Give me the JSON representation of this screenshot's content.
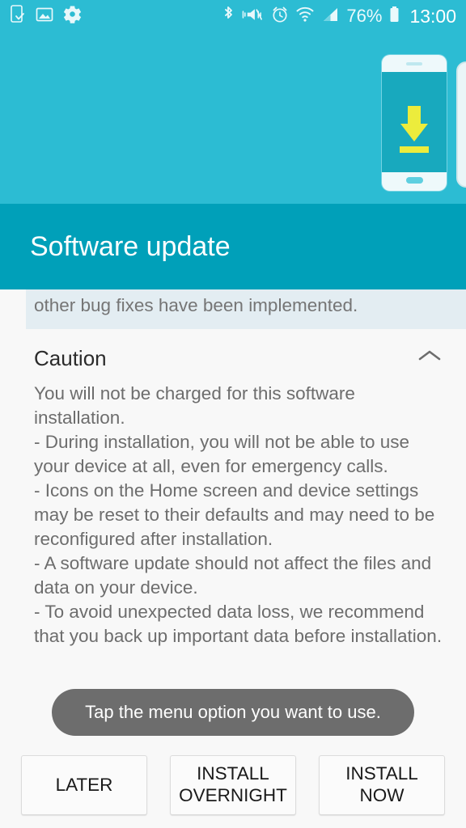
{
  "status_bar": {
    "icons_left": [
      "app-install-icon",
      "screenshot-image-icon",
      "settings-gear-icon"
    ],
    "icons_right": [
      "bluetooth-icon",
      "vibrate-mute-icon",
      "alarm-icon",
      "wifi-icon",
      "cellular-signal-icon"
    ],
    "battery_percent": "76%",
    "time": "13:00"
  },
  "hero": {
    "illustration": "phone-with-download-arrow",
    "background_color": "#2cbcd3",
    "arrow_color": "#ecec3c"
  },
  "header": {
    "title": "Software update",
    "background_color": "#00a0b9"
  },
  "content": {
    "release_note": "other bug fixes have been implemented.",
    "caution": {
      "title": "Caution",
      "collapse_icon": "chevron-up-icon",
      "body": "You will not be charged for this software installation.\n- During installation, you will not be able to use your device at all, even for emergency calls.\n- Icons on the Home screen and device settings may be reset to their defaults and may need to be reconfigured after installation.\n- A software update should not affect the files and data on your device.\n- To avoid unexpected data loss, we recommend that you back up important data before installation."
    }
  },
  "toast": {
    "message": "Tap the menu option you want to use."
  },
  "buttons": [
    {
      "label": "LATER",
      "name": "later-button"
    },
    {
      "label": "INSTALL\nOVERNIGHT",
      "name": "install-overnight-button"
    },
    {
      "label": "INSTALL\nNOW",
      "name": "install-now-button"
    }
  ]
}
